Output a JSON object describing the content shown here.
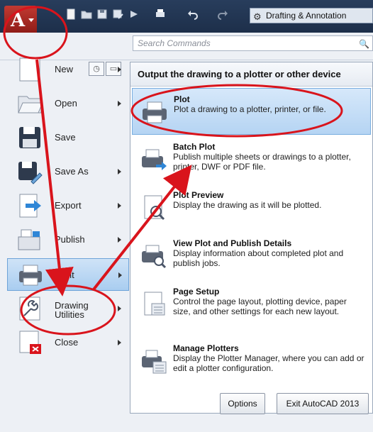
{
  "titlebar": {
    "app_logo": "A",
    "workspace_label": "Drafting & Annotation",
    "quick_access_icons": [
      "new-icon",
      "open-icon",
      "save-icon",
      "saveas-icon",
      "plot-icon",
      "print-icon",
      "undo-icon",
      "redo-icon"
    ]
  },
  "search": {
    "placeholder": "Search Commands"
  },
  "left_menu": {
    "items": [
      {
        "label": "New",
        "icon": "new-file-icon",
        "has_arrow": true
      },
      {
        "label": "Open",
        "icon": "open-folder-icon",
        "has_arrow": true
      },
      {
        "label": "Save",
        "icon": "save-icon",
        "has_arrow": false
      },
      {
        "label": "Save As",
        "icon": "save-as-icon",
        "has_arrow": true
      },
      {
        "label": "Export",
        "icon": "export-icon",
        "has_arrow": true
      },
      {
        "label": "Publish",
        "icon": "publish-icon",
        "has_arrow": true
      },
      {
        "label": "Print",
        "icon": "printer-icon",
        "has_arrow": true,
        "active": true
      },
      {
        "label_line1": "Drawing",
        "label_line2": "Utilities",
        "icon": "wrench-icon",
        "has_arrow": true
      },
      {
        "label": "Close",
        "icon": "close-drawing-icon",
        "has_arrow": true
      }
    ]
  },
  "submenu": {
    "header": "Output the drawing to a plotter or other device",
    "items": [
      {
        "title": "Plot",
        "desc": "Plot a drawing to a plotter, printer, or file.",
        "active": true
      },
      {
        "title": "Batch Plot",
        "desc": "Publish multiple sheets or drawings to a plotter, printer, DWF or PDF file."
      },
      {
        "title": "Plot Preview",
        "desc": "Display the drawing as it will be plotted."
      },
      {
        "title": "View Plot and Publish Details",
        "desc": "Display information about completed plot and publish jobs."
      },
      {
        "title": "Page Setup",
        "desc": "Control the page layout, plotting device, paper size, and other settings for each new layout."
      },
      {
        "title": "Manage Plotters",
        "desc": "Display the Plotter Manager, where you can add or edit a plotter configuration."
      }
    ]
  },
  "buttons": {
    "options": "Options",
    "exit": "Exit AutoCAD 2013"
  },
  "colors": {
    "accent_red": "#d9141c",
    "highlight_blue": "#b5d4f3",
    "title_bar": "#1d2f4a"
  }
}
